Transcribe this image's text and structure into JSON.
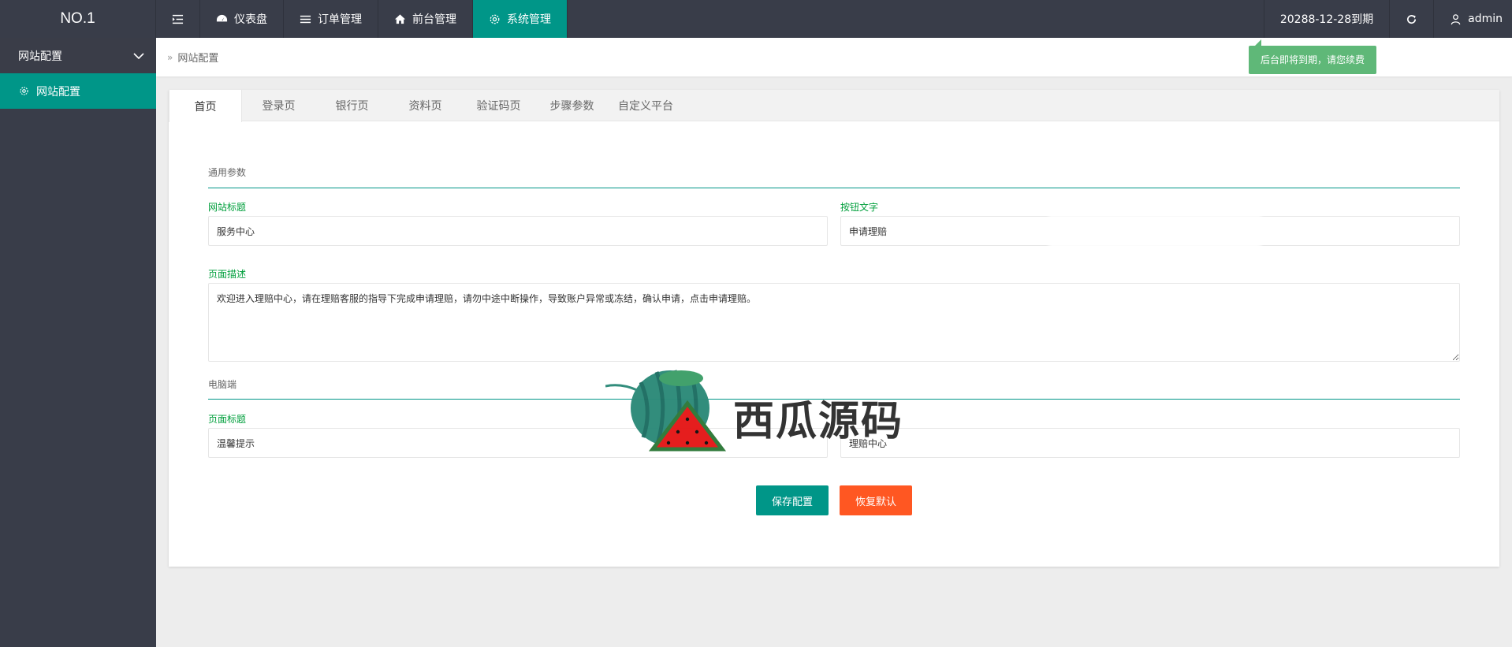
{
  "header": {
    "logo": "NO.1",
    "nav": [
      {
        "label": "仪表盘",
        "icon": "dashboard-icon"
      },
      {
        "label": "订单管理",
        "icon": "list-icon"
      },
      {
        "label": "前台管理",
        "icon": "home-icon"
      },
      {
        "label": "系统管理",
        "icon": "gear-icon",
        "active": true
      }
    ],
    "expire": "20288-12-28到期",
    "user": "admin"
  },
  "sidebar": {
    "group": "网站配置",
    "items": [
      {
        "label": "网站配置",
        "active": true
      }
    ]
  },
  "breadcrumb": {
    "current": "网站配置"
  },
  "tooltip": "后台即将到期，请您续费",
  "tabs": [
    "首页",
    "登录页",
    "银行页",
    "资料页",
    "验证码页",
    "步骤参数",
    "自定义平台"
  ],
  "form": {
    "section_general": "通用参数",
    "site_title_label": "网站标题",
    "site_title_value": "服务中心",
    "button_text_label": "按钮文字",
    "button_text_value": "申请理赔",
    "page_desc_label": "页面描述",
    "page_desc_value": "欢迎进入理赔中心，请在理赔客服的指导下完成申请理赔，请勿中途中断操作，导致账户异常或冻结，确认申请，点击申请理赔。",
    "section_pc": "电脑端",
    "page_title_label": "页面标题",
    "page_title_value": "温馨提示",
    "right_value": "理赔中心"
  },
  "buttons": {
    "save": "保存配置",
    "reset": "恢复默认"
  },
  "watermark": {
    "text": "西瓜源码"
  },
  "colors": {
    "primary": "#009688",
    "danger": "#ff5722",
    "sidebar": "#393d49",
    "tooltip": "#5fb878"
  }
}
